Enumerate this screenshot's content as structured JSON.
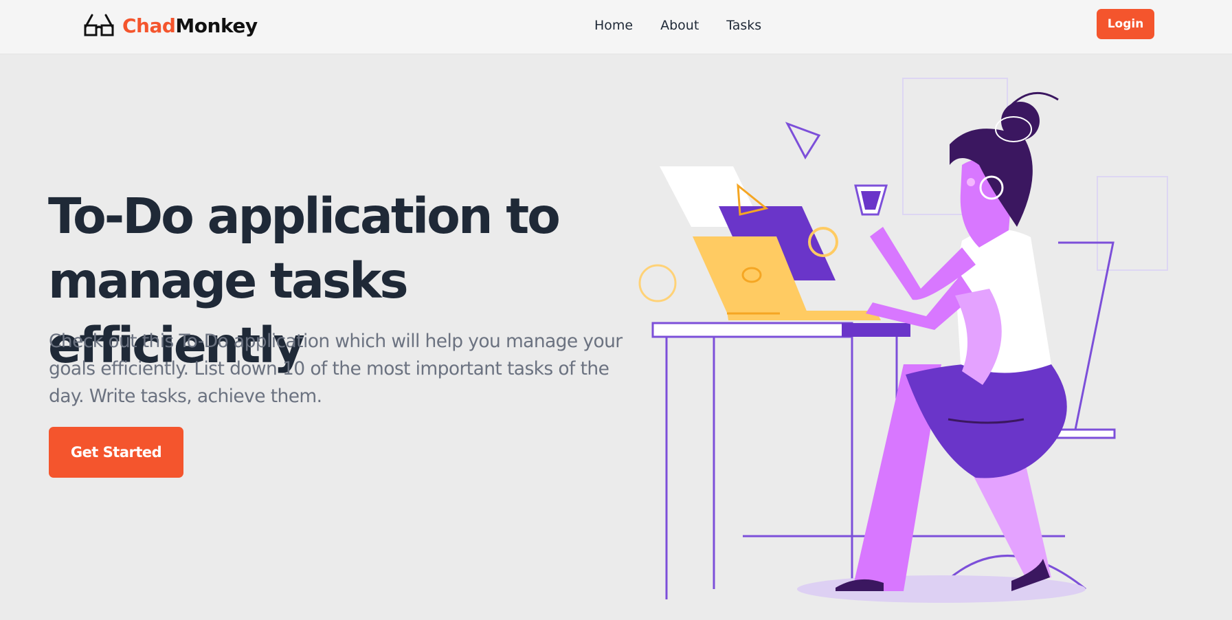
{
  "navbar": {
    "brand_part1": "Chad",
    "brand_part2": "Monkey",
    "links": [
      "Home",
      "About",
      "Tasks"
    ],
    "login_label": "Login"
  },
  "hero": {
    "title": "To-Do application to manage tasks efficiently",
    "description": "Check out this To-Do application which will help you manage your goals efficiently. List down 10 of the most important tasks of the day. Write tasks, achieve them.",
    "cta_label": "Get Started"
  },
  "colors": {
    "accent": "#f4552d",
    "page_bg": "#ebebeb",
    "nav_bg": "#f5f5f5",
    "heading": "#1f2937",
    "body_text": "#6b7280",
    "illustration_purple": "#6a35c9",
    "illustration_pink": "#d877ff",
    "illustration_yellow": "#ffcb62"
  },
  "icons": {
    "logo": "glasses-icon"
  }
}
